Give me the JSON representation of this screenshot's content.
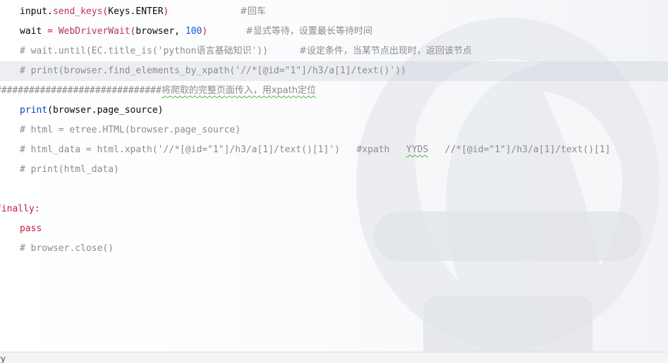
{
  "editor": {
    "lines": [
      {
        "send_keys": {
          "obj": "input",
          "dot": ".",
          "method": "send_keys",
          "open": "(",
          "arg": "Keys.ENTER",
          "close": ")",
          "comment": "#回车"
        }
      }
    ],
    "line_wait": {
      "var": "wait",
      "eq": " = ",
      "cls": "WebDriverWait",
      "open": "(",
      "arg1": "browser, ",
      "num": "100",
      "close": ")",
      "comment": "#显式等待，设置最长等待时间"
    },
    "line_until": {
      "code": "# wait.until(EC.title_is('python",
      "cn": "语言基础知识",
      "code_end": "'))",
      "comment": "#设定条件，当某节点出现时，返回该节点"
    },
    "line_print_xpath": {
      "code": "# print(browser.find_elements_by_xpath('//*[@id=\"1\"]/h3/a[1]/text()'))"
    },
    "line_hashes": {
      "hashes": "##############################",
      "comment": "将爬取的完整页面传入，用xpath定位"
    },
    "line_print_source": {
      "fn": "print",
      "args": "(browser.page_source)"
    },
    "line_html": {
      "code": "# html = etree.HTML(browser.page_source)"
    },
    "line_html_data": {
      "code": "# html_data = html.xpath('//*[@id=\"1\"]/h3/a[1]/text()[1]')   #xpath   ",
      "yyds": "YYDS",
      "code_end": "   //*[@id=\"1\"]/h3/a[1]/text()[1]"
    },
    "line_print_html_data": {
      "code": "# print(html_data)"
    },
    "line_finally": {
      "kw": "finally:"
    },
    "line_pass": {
      "kw": "pass"
    },
    "line_close": {
      "code": "# browser.close()"
    }
  },
  "bottom_bar": {
    "label": "try"
  },
  "colors": {
    "method": "#b8345b",
    "class": "#b8345b",
    "number": "#1750eb",
    "builtin": "#0a46b8",
    "keyword": "#c21f3a",
    "comment": "#8c8c8c",
    "highlight": "#e8eaef"
  }
}
